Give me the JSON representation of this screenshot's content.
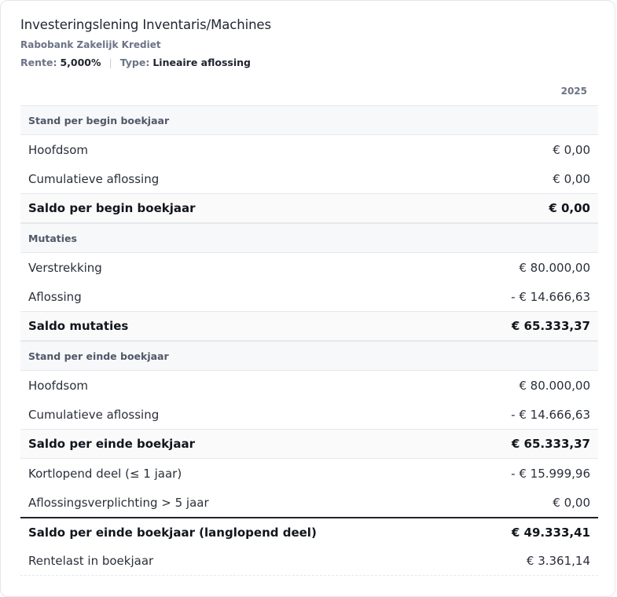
{
  "header": {
    "title": "Investeringslening Inventaris/Machines",
    "bank": "Rabobank Zakelijk Krediet",
    "rente_label": "Rente:",
    "rente_value": "5,000%",
    "separator": "|",
    "type_label": "Type:",
    "type_value": "Lineaire aflossing"
  },
  "table": {
    "year": "2025",
    "rows": [
      {
        "kind": "section",
        "label": "Stand per begin boekjaar",
        "value": ""
      },
      {
        "kind": "item",
        "label": "Hoofdsom",
        "value": "€ 0,00"
      },
      {
        "kind": "item",
        "label": "Cumulatieve aflossing",
        "value": "€ 0,00"
      },
      {
        "kind": "total",
        "label": "Saldo per begin boekjaar",
        "value": "€ 0,00"
      },
      {
        "kind": "section",
        "label": "Mutaties",
        "value": ""
      },
      {
        "kind": "item",
        "label": "Verstrekking",
        "value": "€ 80.000,00"
      },
      {
        "kind": "item",
        "label": "Aflossing",
        "value": "- € 14.666,63"
      },
      {
        "kind": "total",
        "label": "Saldo mutaties",
        "value": "€ 65.333,37"
      },
      {
        "kind": "section",
        "label": "Stand per einde boekjaar",
        "value": ""
      },
      {
        "kind": "item",
        "label": "Hoofdsom",
        "value": "€ 80.000,00"
      },
      {
        "kind": "item",
        "label": "Cumulatieve aflossing",
        "value": "- € 14.666,63"
      },
      {
        "kind": "total",
        "label": "Saldo per einde boekjaar",
        "value": "€ 65.333,37"
      },
      {
        "kind": "item",
        "label": "Kortlopend deel (≤ 1 jaar)",
        "value": "- € 15.999,96"
      },
      {
        "kind": "item",
        "label": "Aflossingsverplichting > 5 jaar",
        "value": "€ 0,00"
      },
      {
        "kind": "grand",
        "label": "Saldo per einde boekjaar (langlopend deel)",
        "value": "€ 49.333,41"
      },
      {
        "kind": "item last",
        "label": "Rentelast in boekjaar",
        "value": "€ 3.361,14"
      }
    ]
  }
}
